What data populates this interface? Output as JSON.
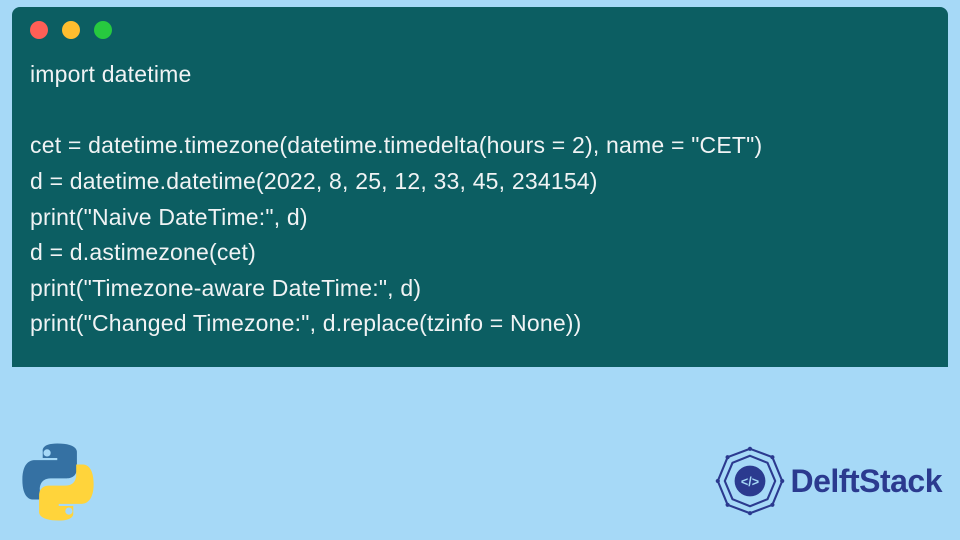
{
  "window": {
    "dot_colors": [
      "#ff5f56",
      "#ffbd2e",
      "#27c93f"
    ]
  },
  "code": {
    "lines": [
      "import datetime",
      "",
      "cet = datetime.timezone(datetime.timedelta(hours = 2), name = \"CET\")",
      "d = datetime.datetime(2022, 8, 25, 12, 33, 45, 234154)",
      "print(\"Naive DateTime:\", d)",
      "d = d.astimezone(cet)",
      "print(\"Timezone-aware DateTime:\", d)",
      "print(\"Changed Timezone:\", d.replace(tzinfo = None))"
    ]
  },
  "branding": {
    "site_name": "DelftStack"
  }
}
